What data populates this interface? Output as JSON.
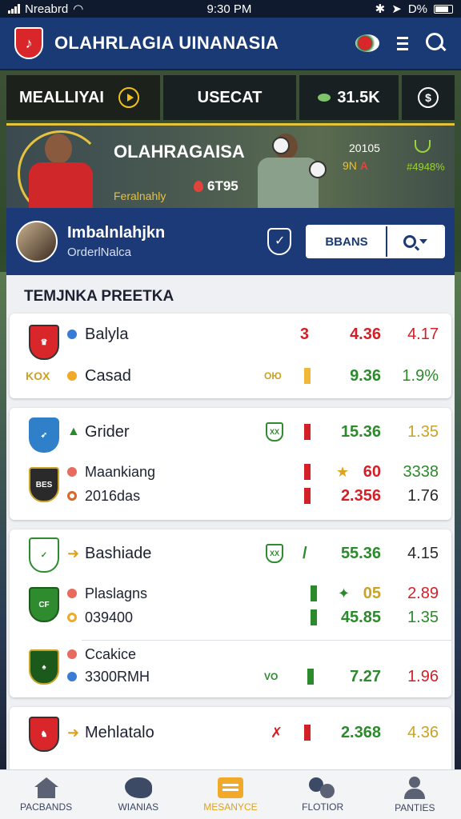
{
  "status": {
    "carrier": "Nreabrd",
    "time": "9:30 PM",
    "battery": "D%"
  },
  "header": {
    "title": "OLAHRLAGIA UINANASIA"
  },
  "tabs": {
    "main_label": "MEALLIYAI",
    "secondary_label": "USECAT",
    "stat_value": "31.5K"
  },
  "featured": {
    "title": "OLAHRAGAISA",
    "subtitle": "Feralnahly",
    "odds": "6T95",
    "date": "20105",
    "code_prefix": "9N",
    "code_suffix": "A",
    "percent": "#4948%"
  },
  "user": {
    "name": "Imbalnlahjkn",
    "subtitle": "OrderlNalca",
    "bet_button": "BBANS"
  },
  "list": {
    "section_title": "TEMJNKA PREETKA",
    "cards": [
      {
        "rows": [
          {
            "badge": "",
            "name": "Balyla",
            "marker": "3",
            "v1": "4.36",
            "v2": "4.17"
          },
          {
            "badge": "KOX",
            "name": "Casad",
            "marker": "ОЮ",
            "v1": "9.36",
            "v2": "1.9%"
          }
        ]
      },
      {
        "rows": [
          {
            "badge": "",
            "name": "Grider",
            "marker": "",
            "v1": "15.36",
            "v2": "1.35"
          },
          {
            "badge": "",
            "name": "Maankiang",
            "marker": "",
            "v1": "60",
            "v2": "3338"
          },
          {
            "badge": "",
            "name": "2016das",
            "marker": "",
            "v1": "2.356",
            "v2": "1.76"
          }
        ]
      },
      {
        "rows": [
          {
            "badge": "",
            "name": "Bashiade",
            "marker": "",
            "v1": "55.36",
            "v2": "4.15"
          },
          {
            "badge": "",
            "name": "Plaslagns",
            "marker": "",
            "v1": "05",
            "v2": "2.89"
          },
          {
            "badge": "",
            "name": "039400",
            "marker": "",
            "v1": "45.85",
            "v2": "1.35"
          },
          {
            "badge": "",
            "name": "Ccakice",
            "marker": "",
            "v1": "",
            "v2": ""
          },
          {
            "badge": "",
            "name": "3300RMH",
            "marker": "",
            "v1": "7.27",
            "v2": "1.96"
          }
        ]
      },
      {
        "rows": [
          {
            "badge": "",
            "name": "Mehlatalo",
            "marker": "",
            "v1": "2.368",
            "v2": "4.36"
          }
        ]
      }
    ]
  },
  "nav": [
    {
      "label": "PACBANDS"
    },
    {
      "label": "WIANIAS"
    },
    {
      "label": "MESANYCE"
    },
    {
      "label": "FLOTIOR"
    },
    {
      "label": "PANTIES"
    }
  ],
  "colors": {
    "primary": "#1a3a75",
    "accent": "#f1c21b",
    "red": "#d32028",
    "green": "#2b8a2b",
    "active_nav": "#e0a21b"
  }
}
